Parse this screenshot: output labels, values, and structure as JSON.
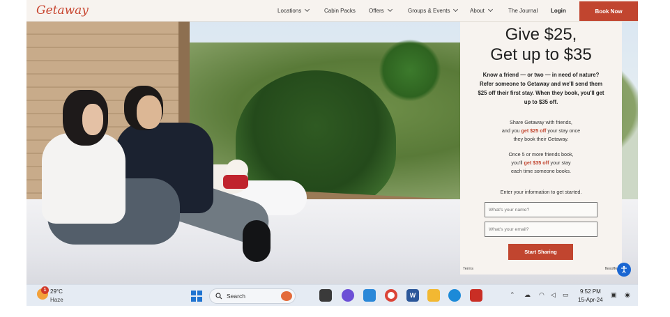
{
  "header": {
    "logo": "Getaway",
    "nav": [
      {
        "label": "Locations",
        "dropdown": true
      },
      {
        "label": "Cabin Packs",
        "dropdown": false
      },
      {
        "label": "Offers",
        "dropdown": true
      },
      {
        "label": "Groups & Events",
        "dropdown": true
      },
      {
        "label": "About",
        "dropdown": true
      },
      {
        "label": "The Journal",
        "dropdown": false
      }
    ],
    "login": "Login",
    "book_now": "Book Now"
  },
  "panel": {
    "headline_line1": "Give $25,",
    "headline_line2": "Get up to $35",
    "intro": "Know a friend — or two — in need of nature? Refer someone to Getaway and we'll send them $25 off their first stay. When they book, you'll get up to $35 off.",
    "para1_a": "Share Getaway with friends,",
    "para1_b": "and you",
    "para1_highlight": "get $25 off",
    "para1_c": "your stay once",
    "para1_d": "they book their Getaway.",
    "para2_a": "Once 5 or more friends book,",
    "para2_b": "you'll",
    "para2_highlight": "get $35 off",
    "para2_c": "your stay",
    "para2_d": "each time someone books.",
    "enter_info": "Enter your information to get started.",
    "name_placeholder": "What's your name?",
    "email_placeholder": "What's your email?",
    "cta": "Start Sharing",
    "terms": "Terms",
    "flexoffers": "flexoffers"
  },
  "taskbar": {
    "weather_badge": "1",
    "temperature": "29°C",
    "condition": "Haze",
    "search_label": "Search",
    "time": "9:52 PM",
    "date": "15-Apr-24",
    "apps": [
      "task-view",
      "copilot",
      "notepad",
      "chrome",
      "word",
      "file-explorer",
      "edge",
      "acrobat"
    ]
  },
  "colors": {
    "brand": "#c1452f",
    "panel_bg": "#f7f3ef",
    "taskbar_bg": "#e5ebf3",
    "accessibility": "#1a66d2"
  }
}
